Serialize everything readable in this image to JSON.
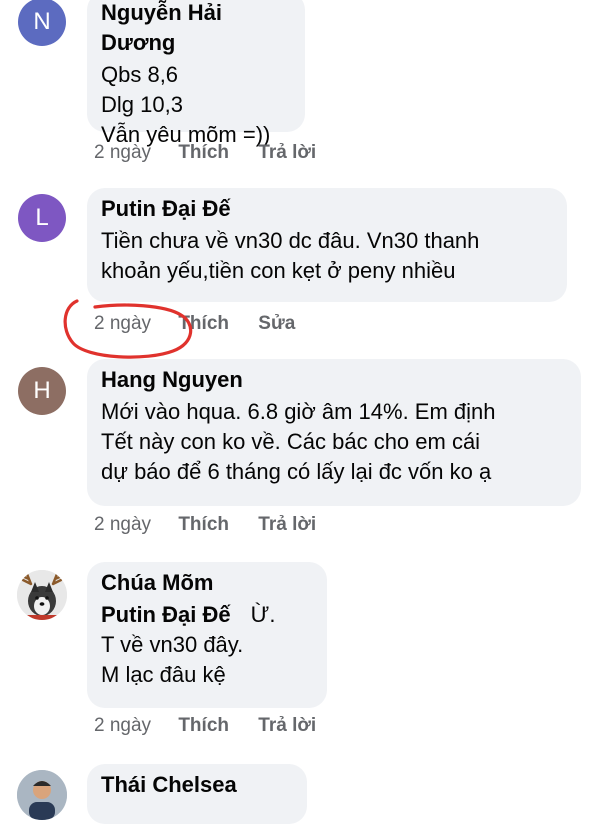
{
  "comments": [
    {
      "initial": "N",
      "avatar_color": "#5c6bc0",
      "author": "Nguyễn Hải Dương",
      "lines": [
        "Qbs 8,6",
        "Dlg 10,3",
        "Vẫn yêu mõm =))"
      ],
      "time": "2 ngày",
      "like": "Thích",
      "reply": "Trả lời"
    },
    {
      "initial": "L",
      "avatar_color": "#7e57c2",
      "author": "Putin Đại Đế",
      "lines": [
        "Tiền chưa về vn30 dc đâu. Vn30 thanh",
        "khoản yếu,tiền con kẹt ở peny nhiều"
      ],
      "time": "2 ngày",
      "like": "Thích",
      "reply": "Sửa"
    },
    {
      "initial": "H",
      "avatar_color": "#8d6e63",
      "author": "Hang Nguyen",
      "lines": [
        "Mới vào hqua. 6.8 giờ âm 14%. Em định",
        "Tết này con ko về. Các bác cho em cái",
        "dự báo để 6 tháng có lấy lại đc vốn ko ạ"
      ],
      "time": "2 ngày",
      "like": "Thích",
      "reply": "Trả lời"
    },
    {
      "author": "Chúa Mõm",
      "mention": "Putin Đại Đế",
      "mention_rest": "Ừ.",
      "lines": [
        "T về vn30 đây.",
        "M lạc đâu kệ"
      ],
      "time": "2 ngày",
      "like": "Thích",
      "reply": "Trả lời"
    },
    {
      "author": "Thái Chelsea"
    }
  ],
  "annotation": {
    "color": "#e0322d",
    "shape": "hand-drawn-circle",
    "target": "comment-2-time"
  },
  "colors": {
    "bubble": "#f0f2f5",
    "meta_text": "#65676b",
    "text": "#050505"
  }
}
